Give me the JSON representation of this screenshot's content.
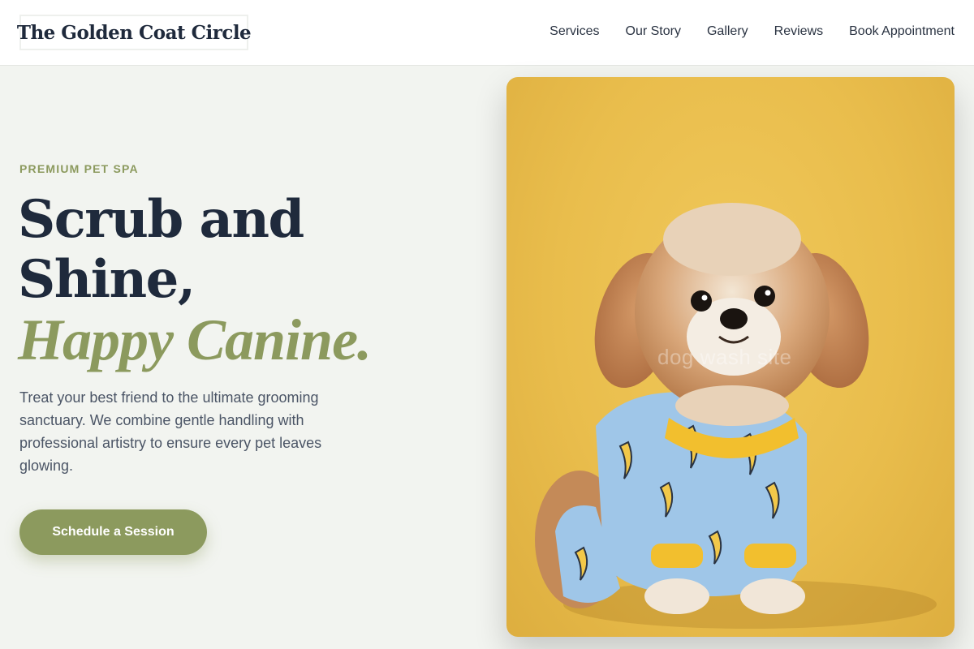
{
  "header": {
    "logo": "The Golden Coat Circle",
    "nav": [
      "Services",
      "Our Story",
      "Gallery",
      "Reviews",
      "Book Appointment"
    ]
  },
  "hero": {
    "eyebrow": "PREMIUM PET SPA",
    "headline_line1": "Scrub and",
    "headline_line2": "Shine,",
    "headline_accent": "Happy Canine.",
    "subcopy": "Treat your best friend to the ultimate grooming sanctuary. We combine gentle handling with professional artistry to ensure every pet leaves glowing.",
    "cta_label": "Schedule a Session",
    "image_watermark": "dog wash site"
  },
  "colors": {
    "accent": "#8c9a5e",
    "heading": "#1f2a3c",
    "background": "#f2f4f0",
    "photo_background": "#e9bd4c"
  }
}
